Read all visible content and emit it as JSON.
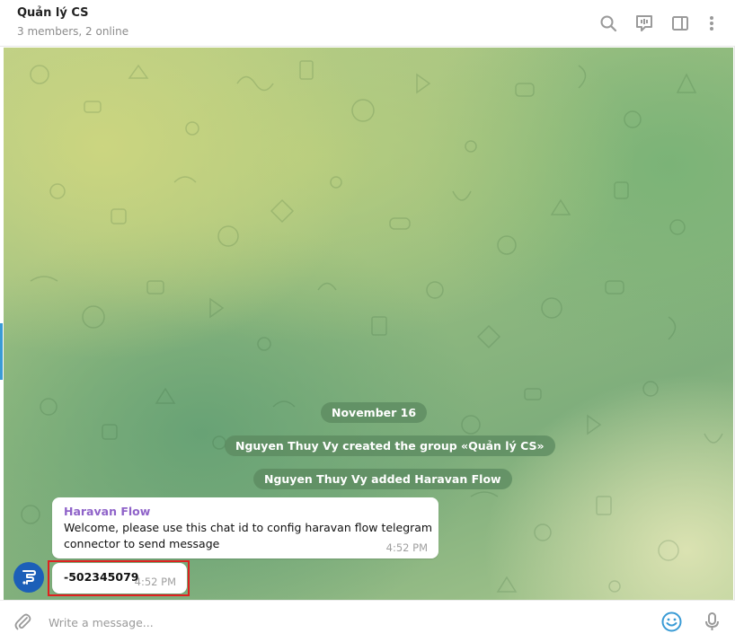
{
  "header": {
    "title": "Quản lý CS",
    "subtitle": "3 members, 2 online",
    "icons": [
      "search-icon",
      "discussion-icon",
      "sidebar-toggle-icon",
      "more-vertical-icon"
    ]
  },
  "chat": {
    "date_label": "November 16",
    "service_messages": [
      "Nguyen Thuy Vy created the group «Quản lý CS»",
      "Nguyen Thuy Vy added Haravan Flow"
    ],
    "messages": [
      {
        "sender": "Haravan Flow",
        "text_line1": "Welcome, please use this chat id to config haravan flow telegram",
        "text_line2": "connector to send message",
        "time": "4:52 PM"
      },
      {
        "text": "-502345079",
        "time": "4:52 PM"
      }
    ]
  },
  "composer": {
    "placeholder": "Write a message...",
    "icons": [
      "paperclip-icon",
      "emoji-icon",
      "microphone-icon"
    ]
  },
  "colors": {
    "accent": "#3a9bd5",
    "sender_name": "#8f63c9",
    "highlight_border": "#e02020",
    "avatar_bg": "#1c5fb8"
  }
}
